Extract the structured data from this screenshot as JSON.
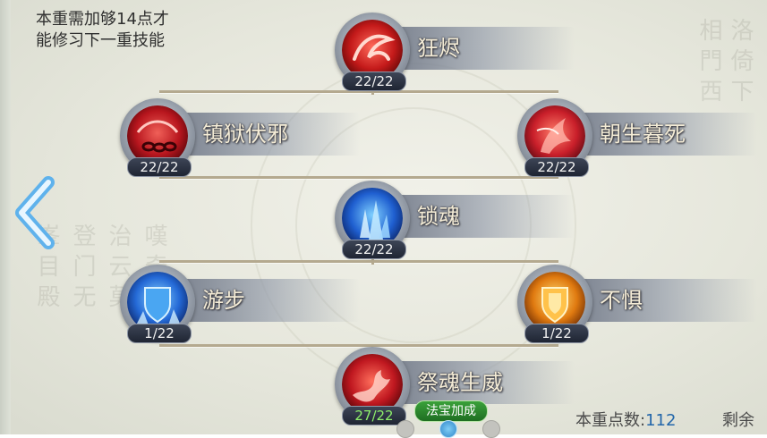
{
  "hint": {
    "line1": "本重需加够14点才",
    "line2": "能修习下一重技能"
  },
  "calligraphy": [
    "相門西",
    "洛倚下",
    "嘆奇錄",
    "治云莫",
    "登门无",
    "峯目殿"
  ],
  "skills": [
    {
      "name": "狂烬",
      "level": "22/22",
      "icon": "red-swirl-skill-icon"
    },
    {
      "name": "镇狱伏邪",
      "level": "22/22",
      "icon": "red-chain-skill-icon"
    },
    {
      "name": "朝生暮死",
      "level": "22/22",
      "icon": "red-flame-skill-icon"
    },
    {
      "name": "锁魂",
      "level": "22/22",
      "icon": "blue-crystal-skill-icon"
    },
    {
      "name": "游步",
      "level": "1/22",
      "icon": "blue-shield-skill-icon"
    },
    {
      "name": "不惧",
      "level": "1/22",
      "icon": "gold-shield-skill-icon"
    },
    {
      "name": "祭魂生威",
      "level": "27/22",
      "icon": "red-dragon-skill-icon"
    }
  ],
  "fabao_badge": "法宝加成",
  "points": {
    "label": "本重点数:",
    "value": "112",
    "remain_label": "剩余"
  },
  "pagination": {
    "count": 3,
    "active": 2
  },
  "colors": {
    "level_bonus": "#8ef06a",
    "badge_green": "#2f8a2f",
    "points_value": "#2266aa"
  }
}
